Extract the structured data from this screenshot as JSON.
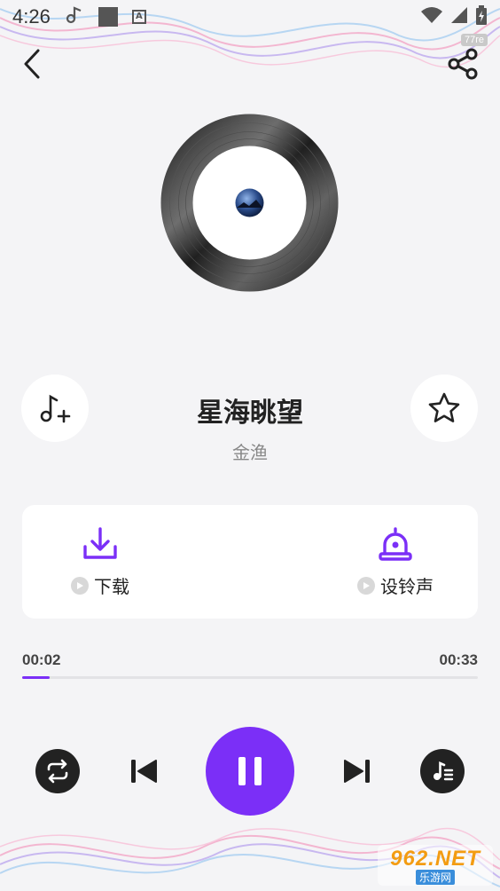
{
  "status_bar": {
    "time": "4:26",
    "icons": [
      "music-note-icon",
      "square-icon",
      "keyboard-a-icon",
      "wifi-icon",
      "signal-icon",
      "battery-icon"
    ]
  },
  "watermark_top": "77re",
  "song": {
    "title": "星海眺望",
    "artist": "金渔"
  },
  "actions": {
    "download_label": "下载",
    "ringtone_label": "设铃声"
  },
  "playback": {
    "current_time": "00:02",
    "total_time": "00:33",
    "progress": 0.06
  },
  "colors": {
    "accent": "#7b2ff7",
    "background": "#f4f4f6",
    "dark_button": "#222222"
  },
  "watermark_bottom": {
    "main": "962.NET",
    "sub": "乐游网"
  }
}
